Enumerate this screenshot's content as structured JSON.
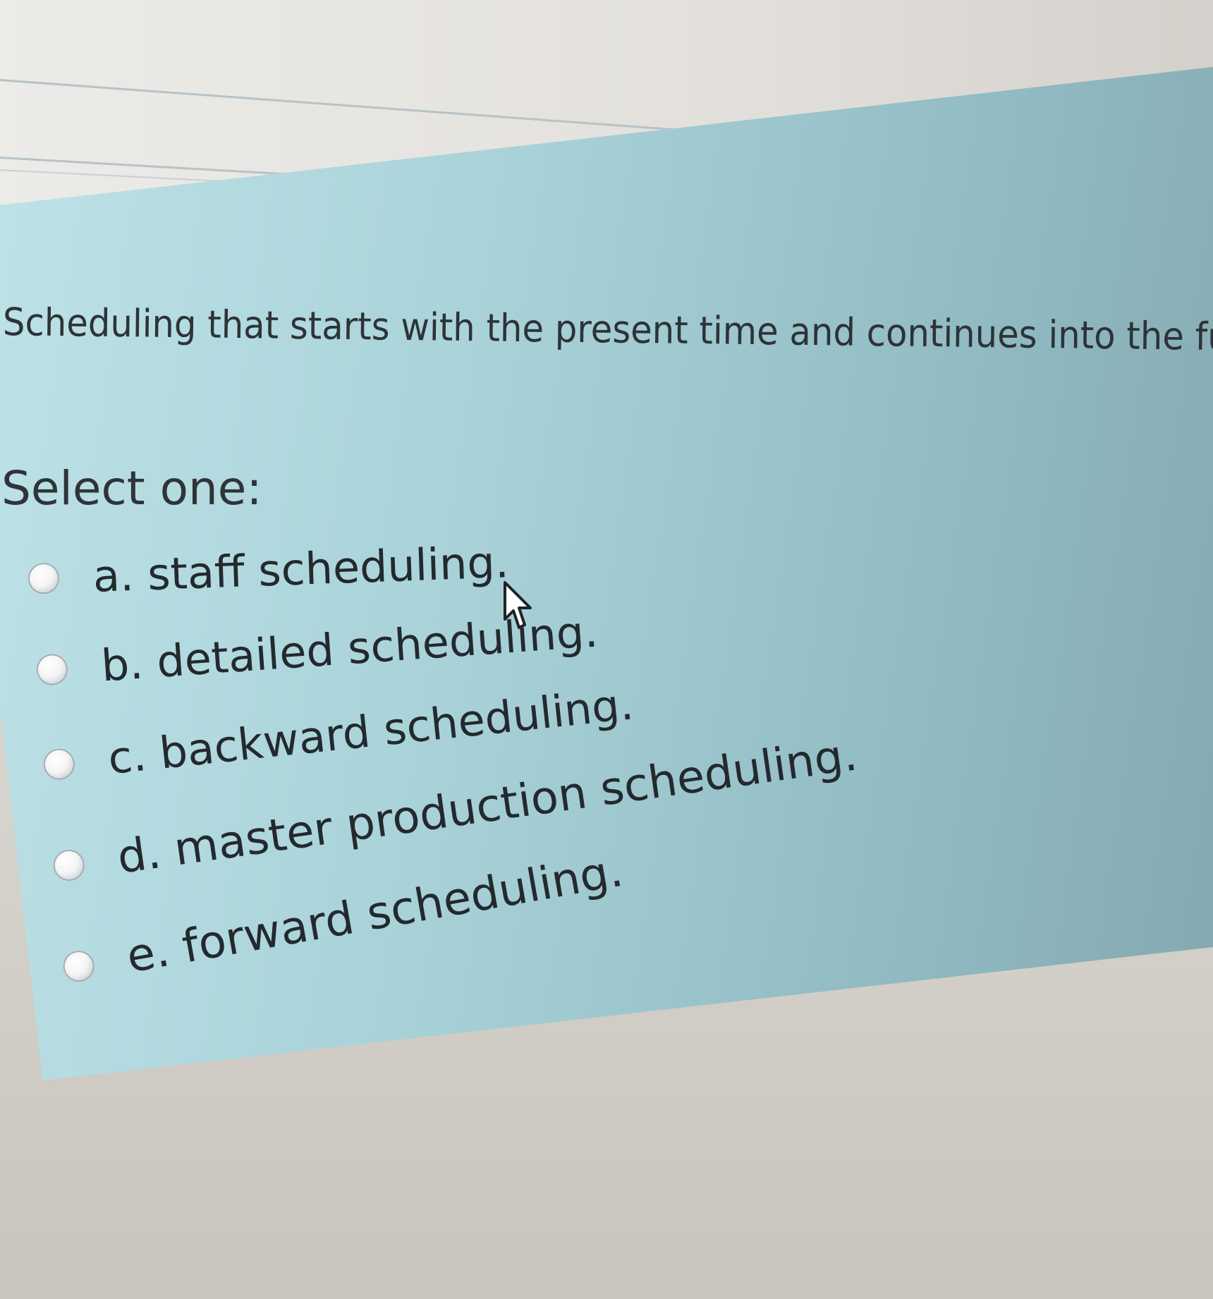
{
  "question": {
    "text": "Scheduling that starts with the present time and continues into the future is called:"
  },
  "prompt": "Select one:",
  "options": [
    {
      "label": "a. staff scheduling."
    },
    {
      "label": "b. detailed scheduling."
    },
    {
      "label": "c. backward scheduling."
    },
    {
      "label": "d. master production scheduling."
    },
    {
      "label": "e. forward scheduling."
    }
  ],
  "colors": {
    "panel": "#a9d3d9",
    "page": "#e3e0dc",
    "text": "#2d3337"
  },
  "icons": {
    "cursor": "arrow-pointer-icon",
    "radio": "radio-button-icon"
  }
}
